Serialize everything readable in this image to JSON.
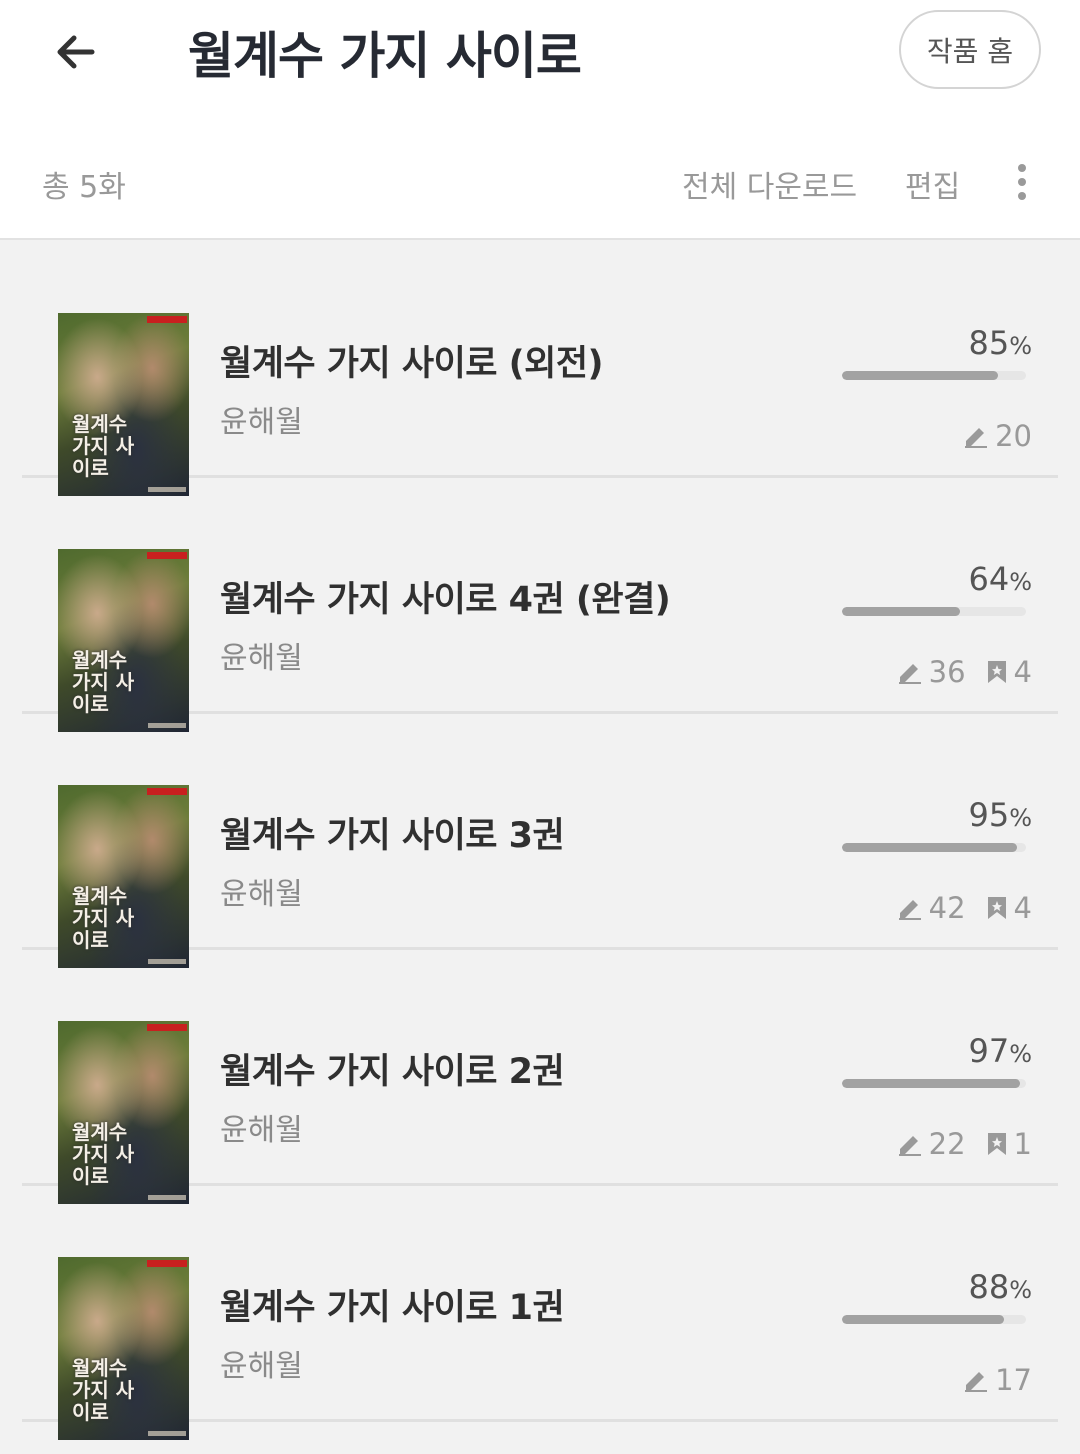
{
  "header": {
    "title": "월계수 가지 사이로",
    "home_button": "작품 홈",
    "back_icon": "arrow-left-icon"
  },
  "toolbar": {
    "total": "총 5화",
    "download_all": "전체 다운로드",
    "edit": "편집",
    "more_icon": "more-vertical-icon"
  },
  "episodes": [
    {
      "title": "월계수 가지 사이로 (외전)",
      "author": "윤해월",
      "percent": "85",
      "progress": 85,
      "notes": "20",
      "bookmarks": null,
      "cover_text": "월계수 가지 사이로"
    },
    {
      "title": "월계수 가지 사이로 4권 (완결)",
      "author": "윤해월",
      "percent": "64",
      "progress": 64,
      "notes": "36",
      "bookmarks": "4",
      "cover_text": "월계수 가지 사이로"
    },
    {
      "title": "월계수 가지 사이로 3권",
      "author": "윤해월",
      "percent": "95",
      "progress": 95,
      "notes": "42",
      "bookmarks": "4",
      "cover_text": "월계수 가지 사이로"
    },
    {
      "title": "월계수 가지 사이로 2권",
      "author": "윤해월",
      "percent": "97",
      "progress": 97,
      "notes": "22",
      "bookmarks": "1",
      "cover_text": "월계수 가지 사이로"
    },
    {
      "title": "월계수 가지 사이로 1권",
      "author": "윤해월",
      "percent": "88",
      "progress": 88,
      "notes": "17",
      "bookmarks": null,
      "cover_text": "월계수 가지 사이로"
    }
  ],
  "percent_unit": "%",
  "colors": {
    "background": "#f2f2f2",
    "header_background": "#ffffff",
    "title_text": "#262a33",
    "progress_fill": "#a2a2a2",
    "progress_track": "#e6e6e6"
  }
}
